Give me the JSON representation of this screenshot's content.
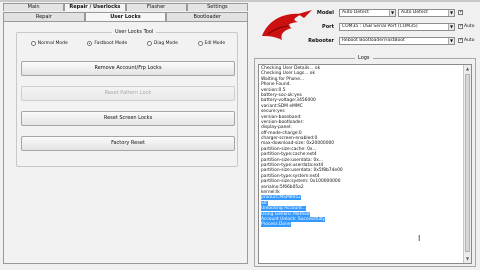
{
  "main_tabs": [
    "Main",
    "Repair / Userlocks",
    "Flasher",
    "Settings"
  ],
  "sub_tabs": [
    "Repair",
    "User Locks",
    "Bootloader"
  ],
  "user_locks": {
    "group_title": "User Locks Tool",
    "modes": [
      {
        "label": "Normal Mode",
        "selected": false
      },
      {
        "label": "Fastboot Mode",
        "selected": true
      },
      {
        "label": "Diag Mode",
        "selected": false
      },
      {
        "label": "Edl Mode",
        "selected": false
      }
    ],
    "buttons": [
      {
        "label": "Remove Account/Frp Locks",
        "enabled": true
      },
      {
        "label": "Reset Pattern Lock",
        "enabled": false
      },
      {
        "label": "Reset Screen Locks",
        "enabled": true
      },
      {
        "label": "Factory Reset",
        "enabled": true
      }
    ]
  },
  "settings": {
    "model_label": "Model",
    "model_value": "Auto Detect",
    "model_value2": "Auto Detect",
    "port_label": "Port",
    "port_value": "COM35 : USB Serial Port (COM35)",
    "rebooter_label": "Rebooter",
    "rebooter_value": "Reboot Bootloader/FastBoot",
    "checkboxes": [
      {
        "label": "",
        "checked": true
      },
      {
        "label": "Auto",
        "checked": true
      },
      {
        "label": "Auto",
        "checked": true
      }
    ]
  },
  "logs": {
    "title": "Logs",
    "lines": [
      {
        "text": "Checking User Details... ok",
        "selected": false
      },
      {
        "text": "Checking User Logs... ok",
        "selected": false
      },
      {
        "text": "Waiting for Phone...",
        "selected": false
      },
      {
        "text": "Phone Found.",
        "selected": false
      },
      {
        "text": "version:0.5",
        "selected": false
      },
      {
        "text": "battery-soc-ok:yes",
        "selected": false
      },
      {
        "text": "battery-voltage:3456000",
        "selected": false
      },
      {
        "text": "variant:SDM eMMC",
        "selected": false
      },
      {
        "text": "secure:yes",
        "selected": false
      },
      {
        "text": "version-baseband:",
        "selected": false
      },
      {
        "text": "version-bootloader:",
        "selected": false
      },
      {
        "text": "display-panel:",
        "selected": false
      },
      {
        "text": "off-mode-charge:0",
        "selected": false
      },
      {
        "text": "charger-screen-enabled:0",
        "selected": false
      },
      {
        "text": "max-download-size: 0x20000000",
        "selected": false
      },
      {
        "text": "partition-size:cache: 0x...",
        "selected": false
      },
      {
        "text": "partition-type:cache:ext4",
        "selected": false
      },
      {
        "text": "partition-size:userdata: 0x...",
        "selected": false
      },
      {
        "text": "partition-type:userdata:ext4",
        "selected": false
      },
      {
        "text": "partition-size:userdata:                0x5f8b74e00",
        "selected": false
      },
      {
        "text": "partition-type:system:ext4",
        "selected": false
      },
      {
        "text": "partition-size:system:                  0x100000000",
        "selected": false
      },
      {
        "text": "serialno:5f66b05a2",
        "selected": false
      },
      {
        "text": "kernel:lk",
        "selected": false
      },
      {
        "text": "product:MSM8952",
        "selected": true
      },
      {
        "text": "all:",
        "selected": true
      },
      {
        "text": "Unlocking Account...",
        "selected": true
      },
      {
        "text": "Using Generic Method",
        "selected": true
      },
      {
        "text": "Account Unlock: Successfully",
        "selected": true
      },
      {
        "text": "Process Done",
        "selected": true
      }
    ]
  }
}
